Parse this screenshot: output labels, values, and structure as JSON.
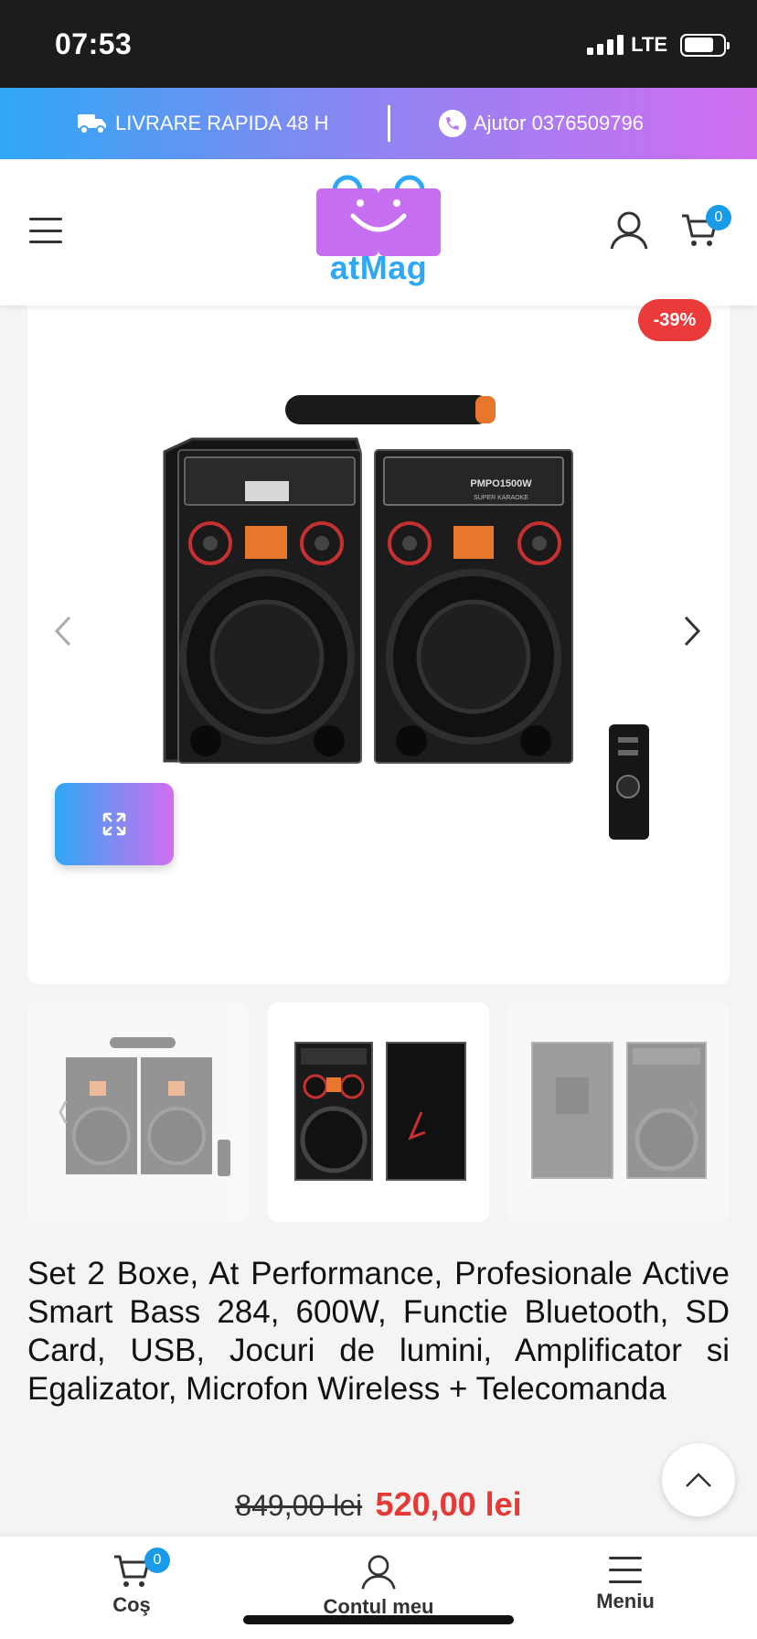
{
  "status_bar": {
    "time": "07:53",
    "network": "LTE"
  },
  "promo": {
    "delivery_text": "LIVRARE RAPIDA  48 H",
    "help_text": "Ajutor 0376509796"
  },
  "header": {
    "logo_text": "atMag",
    "cart_count": "0"
  },
  "product": {
    "discount": "-39%",
    "title": "Set 2 Boxe, At Performance, Profesionale Active Smart Bass 284, 600W, Functie Bluetooth, SD Card, USB, Jocuri de lumini, Amplificator si Egalizator, Microfon Wireless + Telecomanda",
    "old_price": "849,00 lei",
    "new_price": "520,00 lei",
    "panel_label_left": "PMPO1500W",
    "panel_label_right": "SUPER KARAOKE"
  },
  "bottom_nav": {
    "cart_label": "Coş",
    "cart_count": "0",
    "account_label": "Contul meu",
    "menu_label": "Meniu"
  },
  "colors": {
    "accent_blue": "#2ea8f5",
    "accent_purple": "#d16ef0",
    "sale_red": "#e53935",
    "badge_blue": "#1a9be8"
  },
  "icons": [
    "truck-icon",
    "phone-icon",
    "menu-icon",
    "user-icon",
    "cart-icon",
    "chevron-left-icon",
    "chevron-right-icon",
    "expand-icon",
    "chevron-up-icon"
  ]
}
